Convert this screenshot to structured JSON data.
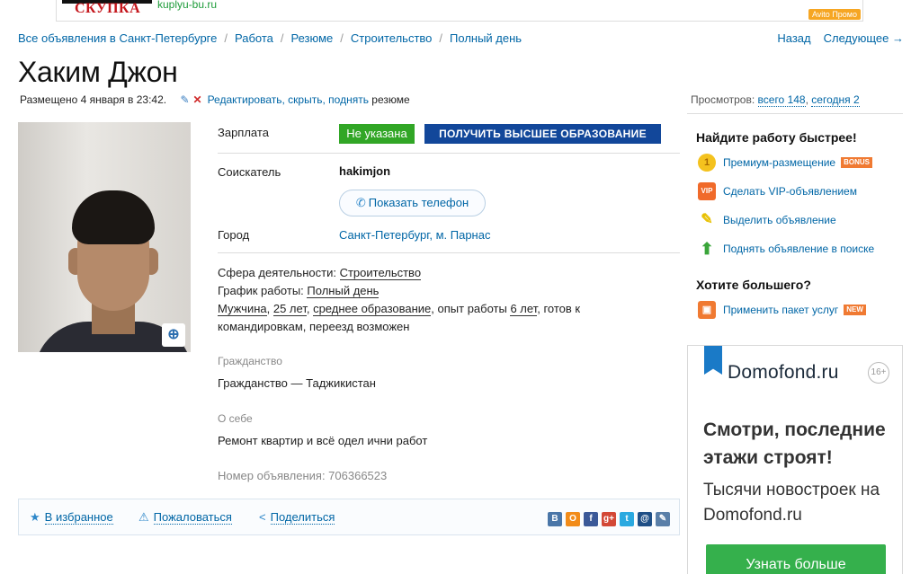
{
  "banner": {
    "logo_text": "СКУПКА",
    "url": "kuplyu-bu.ru",
    "promo": "Avito Промо"
  },
  "breadcrumbs": [
    "Все объявления в Санкт-Петербурге",
    "Работа",
    "Резюме",
    "Строительство",
    "Полный день"
  ],
  "pager": {
    "back": "Назад",
    "next": "Следующее →"
  },
  "title": "Хаким Джон",
  "meta": {
    "posted": "Размещено 4 января в 23:42.",
    "edit": "Редактировать",
    "hide": "скрыть",
    "raise": "поднять",
    "suffix": "резюме",
    "comma": ","
  },
  "views": {
    "label": "Просмотров:",
    "total": "всего 148",
    "today": "сегодня 2",
    "sep": ","
  },
  "details": {
    "salary_label": "Зарплата",
    "salary_value": "Не указана",
    "education_banner": "ПОЛУЧИТЬ ВЫСШЕЕ ОБРАЗОВАНИЕ",
    "seeker_label": "Соискатель",
    "seeker_value": "hakimjon",
    "phone_button": "Показать телефон",
    "city_label": "Город",
    "city_value": "Санкт-Петербург, м. Парнас"
  },
  "info": {
    "sphere_label": "Сфера деятельности:",
    "sphere_value": "Строительство",
    "schedule_label": "График работы:",
    "schedule_value": "Полный день",
    "gender": "Мужчина",
    "age": "25 лет",
    "education": "среднее образование",
    "experience_prefix": "опыт работы",
    "experience_value": "6 лет",
    "rest": "готов к командировкам, переезд возможен"
  },
  "citizenship": {
    "label": "Гражданство",
    "value": "Гражданство — Таджикистан"
  },
  "about": {
    "label": "О себе",
    "value": "Ремонт квартир и всё одел ични работ"
  },
  "ad_number": "Номер объявления: 706366523",
  "actions": {
    "favorite": "В избранное",
    "complain": "Пожаловаться",
    "share": "Поделиться"
  },
  "socials": [
    {
      "name": "vk-icon",
      "glyph": "B",
      "color": "#4a76a8"
    },
    {
      "name": "odnoklassniki-icon",
      "glyph": "О",
      "color": "#f28c1a"
    },
    {
      "name": "facebook-icon",
      "glyph": "f",
      "color": "#3b5998"
    },
    {
      "name": "google-plus-icon",
      "glyph": "g+",
      "color": "#d34836"
    },
    {
      "name": "twitter-icon",
      "glyph": "t",
      "color": "#2aa9e0"
    },
    {
      "name": "mail-icon",
      "glyph": "@",
      "color": "#1f4f86"
    },
    {
      "name": "livejournal-icon",
      "glyph": "✎",
      "color": "#5a7fa8"
    }
  ],
  "sidebar": {
    "heading1": "Найдите работу быстрее!",
    "items": [
      {
        "label": "Премиум-размещение",
        "badge": "BONUS",
        "icon": "premium-coin-icon"
      },
      {
        "label": "Сделать VIP-объявлением",
        "icon": "vip-icon"
      },
      {
        "label": "Выделить объявление",
        "icon": "highlight-marker-icon"
      },
      {
        "label": "Поднять объявление в поиске",
        "icon": "raise-arrow-icon"
      }
    ],
    "heading2": "Хотите большего?",
    "package": {
      "label": "Применить пакет услуг",
      "badge": "NEW",
      "icon": "package-box-icon"
    }
  },
  "ad": {
    "brand": "Domofond.ru",
    "age": "16+",
    "headline": "Смотри, последние этажи строят!",
    "subline": "Тысячи новостроек на Domofond.ru",
    "cta": "Узнать больше"
  },
  "colors": {
    "link": "#0066a6",
    "salary_green": "#31a626",
    "edu_blue": "#12479a",
    "cta_green": "#35b04c",
    "domofond_blue": "#1a7ac7"
  }
}
